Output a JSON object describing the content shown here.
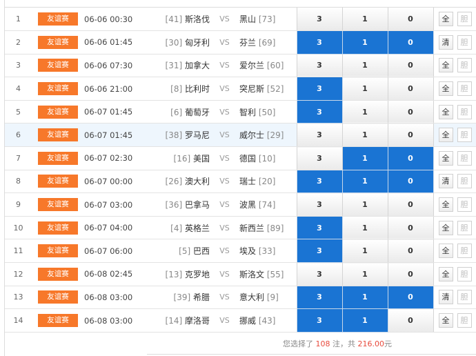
{
  "rows": [
    {
      "idx": "1",
      "league": "友谊赛",
      "time": "06-06 00:30",
      "home_rank": "[41]",
      "home": "斯洛伐",
      "vs": "VS",
      "away": "黑山",
      "away_rank": "[73]",
      "odds": [
        "3",
        "1",
        "0"
      ],
      "sel": [
        false,
        false,
        false
      ],
      "btn1": "全",
      "btn2": "胆"
    },
    {
      "idx": "2",
      "league": "友谊赛",
      "time": "06-06 01:45",
      "home_rank": "[30]",
      "home": "匈牙利",
      "vs": "VS",
      "away": "芬兰",
      "away_rank": "[69]",
      "odds": [
        "3",
        "1",
        "0"
      ],
      "sel": [
        true,
        true,
        true
      ],
      "btn1": "清",
      "btn2": "胆"
    },
    {
      "idx": "3",
      "league": "友谊赛",
      "time": "06-06 07:30",
      "home_rank": "[31]",
      "home": "加拿大",
      "vs": "VS",
      "away": "爱尔兰",
      "away_rank": "[60]",
      "odds": [
        "3",
        "1",
        "0"
      ],
      "sel": [
        false,
        false,
        false
      ],
      "btn1": "全",
      "btn2": "胆"
    },
    {
      "idx": "4",
      "league": "友谊赛",
      "time": "06-06 21:00",
      "home_rank": "[8]",
      "home": "比利时",
      "vs": "VS",
      "away": "突尼斯",
      "away_rank": "[52]",
      "odds": [
        "3",
        "1",
        "0"
      ],
      "sel": [
        true,
        false,
        false
      ],
      "btn1": "全",
      "btn2": "胆"
    },
    {
      "idx": "5",
      "league": "友谊赛",
      "time": "06-07 01:45",
      "home_rank": "[6]",
      "home": "葡萄牙",
      "vs": "VS",
      "away": "智利",
      "away_rank": "[50]",
      "odds": [
        "3",
        "1",
        "0"
      ],
      "sel": [
        true,
        false,
        false
      ],
      "btn1": "全",
      "btn2": "胆"
    },
    {
      "idx": "6",
      "league": "友谊赛",
      "time": "06-07 01:45",
      "home_rank": "[38]",
      "home": "罗马尼",
      "vs": "VS",
      "away": "威尔士",
      "away_rank": "[29]",
      "odds": [
        "3",
        "1",
        "0"
      ],
      "sel": [
        false,
        false,
        false
      ],
      "btn1": "全",
      "btn2": "胆"
    },
    {
      "idx": "7",
      "league": "友谊赛",
      "time": "06-07 02:30",
      "home_rank": "[16]",
      "home": "美国",
      "vs": "VS",
      "away": "德国",
      "away_rank": "[10]",
      "odds": [
        "3",
        "1",
        "0"
      ],
      "sel": [
        false,
        true,
        true
      ],
      "btn1": "全",
      "btn2": "胆"
    },
    {
      "idx": "8",
      "league": "友谊赛",
      "time": "06-07 00:00",
      "home_rank": "[26]",
      "home": "澳大利",
      "vs": "VS",
      "away": "瑞士",
      "away_rank": "[20]",
      "odds": [
        "3",
        "1",
        "0"
      ],
      "sel": [
        true,
        true,
        true
      ],
      "btn1": "清",
      "btn2": "胆"
    },
    {
      "idx": "9",
      "league": "友谊赛",
      "time": "06-07 03:00",
      "home_rank": "[36]",
      "home": "巴拿马",
      "vs": "VS",
      "away": "波黑",
      "away_rank": "[74]",
      "odds": [
        "3",
        "1",
        "0"
      ],
      "sel": [
        false,
        false,
        false
      ],
      "btn1": "全",
      "btn2": "胆"
    },
    {
      "idx": "10",
      "league": "友谊赛",
      "time": "06-07 04:00",
      "home_rank": "[4]",
      "home": "英格兰",
      "vs": "VS",
      "away": "新西兰",
      "away_rank": "[89]",
      "odds": [
        "3",
        "1",
        "0"
      ],
      "sel": [
        true,
        false,
        false
      ],
      "btn1": "全",
      "btn2": "胆"
    },
    {
      "idx": "11",
      "league": "友谊赛",
      "time": "06-07 06:00",
      "home_rank": "[5]",
      "home": "巴西",
      "vs": "VS",
      "away": "埃及",
      "away_rank": "[33]",
      "odds": [
        "3",
        "1",
        "0"
      ],
      "sel": [
        true,
        false,
        false
      ],
      "btn1": "全",
      "btn2": "胆"
    },
    {
      "idx": "12",
      "league": "友谊赛",
      "time": "06-08 02:45",
      "home_rank": "[13]",
      "home": "克罗地",
      "vs": "VS",
      "away": "斯洛文",
      "away_rank": "[55]",
      "odds": [
        "3",
        "1",
        "0"
      ],
      "sel": [
        false,
        false,
        false
      ],
      "btn1": "全",
      "btn2": "胆"
    },
    {
      "idx": "13",
      "league": "友谊赛",
      "time": "06-08 03:00",
      "home_rank": "[39]",
      "home": "希腊",
      "vs": "VS",
      "away": "意大利",
      "away_rank": "[9]",
      "odds": [
        "3",
        "1",
        "0"
      ],
      "sel": [
        true,
        true,
        true
      ],
      "btn1": "清",
      "btn2": "胆"
    },
    {
      "idx": "14",
      "league": "友谊赛",
      "time": "06-08 03:00",
      "home_rank": "[14]",
      "home": "摩洛哥",
      "vs": "VS",
      "away": "挪威",
      "away_rank": "[43]",
      "odds": [
        "3",
        "1",
        "0"
      ],
      "sel": [
        true,
        true,
        false
      ],
      "btn1": "全",
      "btn2": "胆"
    }
  ],
  "highlight_row": 6,
  "summary": {
    "prefix": "您选择了",
    "count": "108",
    "mid": "注，共",
    "amount": "216.00",
    "suffix": "元"
  },
  "colors": {
    "league_badge": "#f7782a",
    "selected_odd": "#1a74d3",
    "highlight_row": "#eef6fd",
    "amount_text": "#e84a3c"
  }
}
